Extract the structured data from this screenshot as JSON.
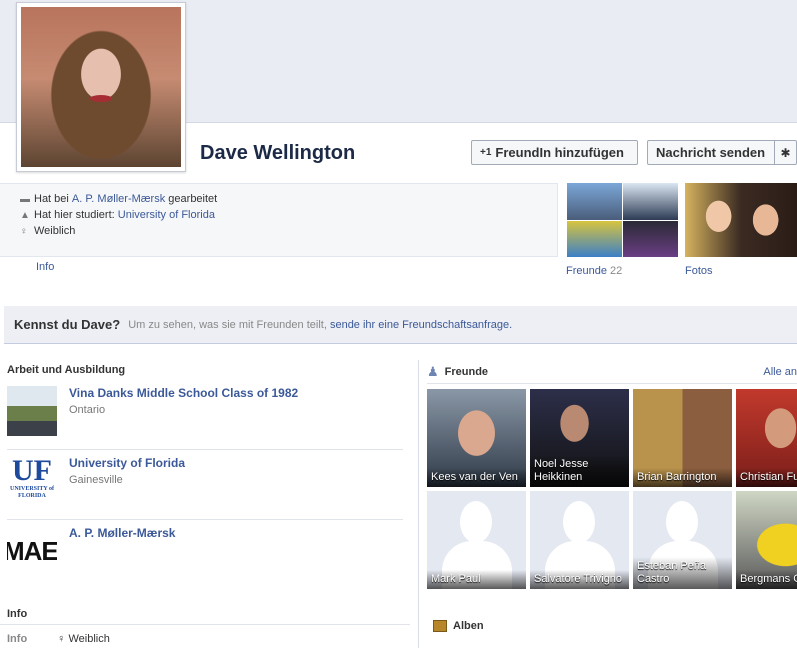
{
  "profile": {
    "name": "Dave Wellington"
  },
  "actions": {
    "add_friend": "FreundIn hinzufügen",
    "add_friend_icon": "+1",
    "send_message": "Nachricht senden",
    "gear": "✱"
  },
  "intro": {
    "work_prefix": "Hat bei ",
    "work_link": "A. P. Møller-Mærsk",
    "work_suffix": " gearbeitet",
    "study_prefix": "Hat hier studiert: ",
    "study_link": "University of Florida",
    "gender": "Weiblich",
    "info_link": "Info"
  },
  "thumbs": {
    "friends_label": "Freunde",
    "friends_count": "22",
    "photos_label": "Fotos"
  },
  "kennst": {
    "title": "Kennst du Dave?",
    "text": "Um zu sehen, was sie mit Freunden teilt,",
    "link": "sende ihr eine Freundschaftsanfrage."
  },
  "work": {
    "heading": "Arbeit und Ausbildung",
    "items": [
      {
        "title": "Vina Danks Middle School Class of 1982",
        "sub": "Ontario"
      },
      {
        "title": "University of Florida",
        "sub": "Gainesville"
      },
      {
        "title": "A. P. Møller-Mærsk",
        "sub": ""
      }
    ],
    "logo_uf": "UF",
    "logo_uf_sub": "UNIVERSITY of FLORIDA",
    "logo_mae": "MAE"
  },
  "info_section": {
    "heading": "Info",
    "label": "Info",
    "gender": "Weiblich"
  },
  "friends_box": {
    "heading": "Freunde",
    "all_link": "Alle an",
    "friends": [
      "Kees van der Ven",
      "Noel Jesse Heikkinen",
      "Brian Barrington",
      "Christian Fu",
      "Mark Paul",
      "Salvatore Trivigno",
      "Esteban Peña Castro",
      "Bergmans G"
    ]
  },
  "albums": {
    "heading": "Alben"
  },
  "colors": {
    "link": "#3b5998",
    "cover": "#e9ecf3",
    "infobox": "#f6f7f9"
  }
}
